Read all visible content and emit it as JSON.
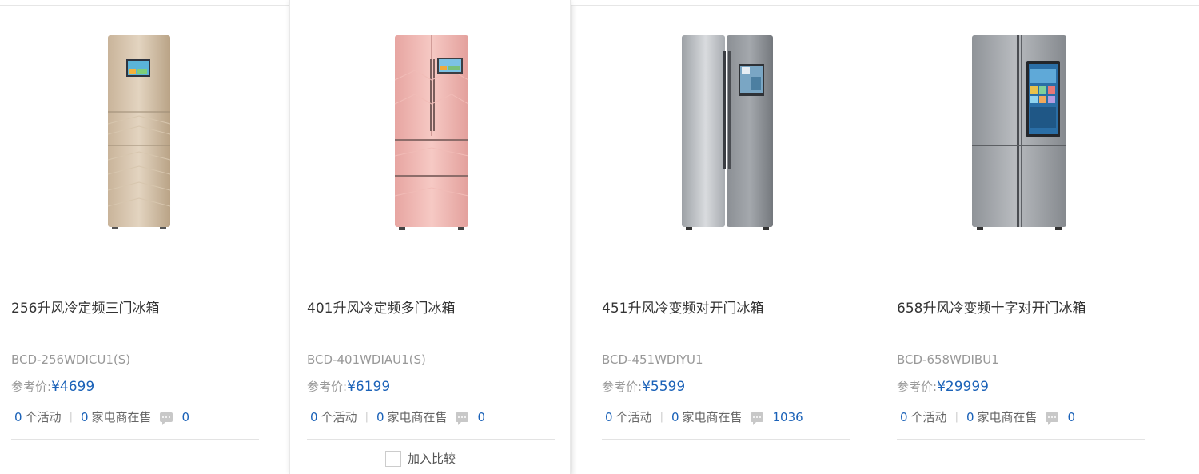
{
  "products": [
    {
      "title": "256升风冷定频三门冰箱",
      "model": "BCD-256WDICU1(S)",
      "price_label": "参考价:",
      "price": "¥4699",
      "activities_count": "0",
      "activities_label": "个活动",
      "dealers_count": "0",
      "dealers_label": "家电商在售",
      "comments": "0"
    },
    {
      "title": "401升风冷定频多门冰箱",
      "model": "BCD-401WDIAU1(S)",
      "price_label": "参考价:",
      "price": "¥6199",
      "activities_count": "0",
      "activities_label": "个活动",
      "dealers_count": "0",
      "dealers_label": "家电商在售",
      "comments": "0",
      "compare_label": "加入比较"
    },
    {
      "title": "451升风冷变频对开门冰箱",
      "model": "BCD-451WDIYU1",
      "price_label": "参考价:",
      "price": "¥5599",
      "activities_count": "0",
      "activities_label": "个活动",
      "dealers_count": "0",
      "dealers_label": "家电商在售",
      "comments": "1036"
    },
    {
      "title": "658升风冷变频十字对开门冰箱",
      "model": "BCD-658WDIBU1",
      "price_label": "参考价:",
      "price": "¥29999",
      "activities_count": "0",
      "activities_label": "个活动",
      "dealers_count": "0",
      "dealers_label": "家电商在售",
      "comments": "0"
    }
  ],
  "colors": {
    "price_blue": "#1b62b8",
    "muted_gray": "#999999",
    "divider": "#e3e3e3"
  }
}
